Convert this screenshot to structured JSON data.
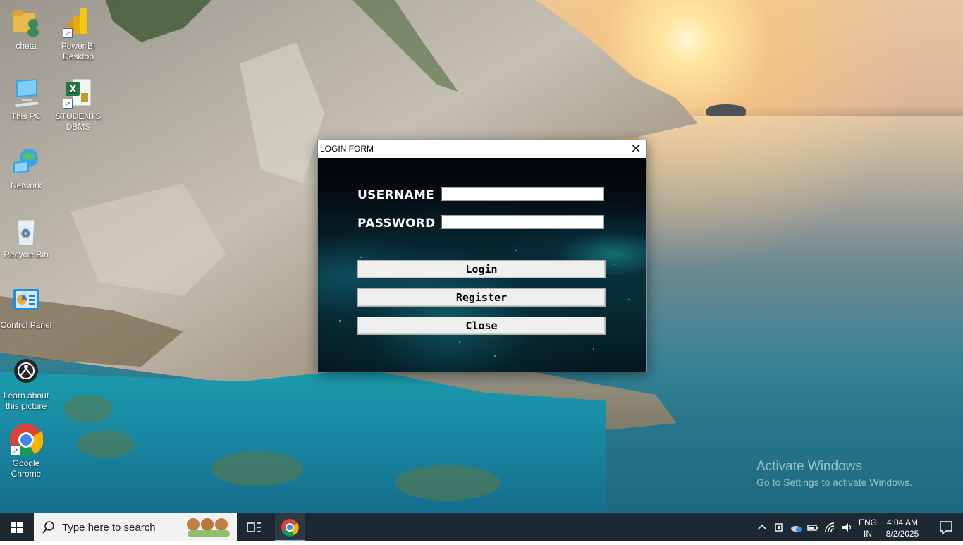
{
  "desktop_icons": [
    {
      "label": "cheta",
      "icon": "user-folder-icon"
    },
    {
      "label": "Power BI Desktop",
      "icon": "power-bi-icon"
    },
    {
      "label": "This PC",
      "icon": "computer-icon"
    },
    {
      "label": "STUDENTS DBMS",
      "icon": "excel-file-icon"
    },
    {
      "label": "Network",
      "icon": "network-icon"
    },
    {
      "label": "Recycle Bin",
      "icon": "recycle-bin-icon"
    },
    {
      "label": "Control Panel",
      "icon": "control-panel-icon"
    },
    {
      "label": "Learn about this picture",
      "icon": "camera-icon"
    },
    {
      "label": "Google Chrome",
      "icon": "chrome-icon"
    }
  ],
  "login_window": {
    "title": "LOGIN FORM",
    "username_label": "USERNAME",
    "password_label": "PASSWORD",
    "username_value": "",
    "password_value": "",
    "buttons": {
      "login": "Login",
      "register": "Register",
      "close": "Close"
    }
  },
  "watermark": {
    "line1": "Activate Windows",
    "line2": "Go to Settings to activate Windows."
  },
  "taskbar": {
    "search_placeholder": "Type here to search",
    "language": "ENG",
    "region": "IN",
    "time": "4:04 AM",
    "date": "8/2/2025",
    "pinned": [
      "chrome-icon"
    ]
  },
  "colors": {
    "taskbar": "#1c2833",
    "login_background": "#06202a",
    "button_face": "#efefef"
  }
}
